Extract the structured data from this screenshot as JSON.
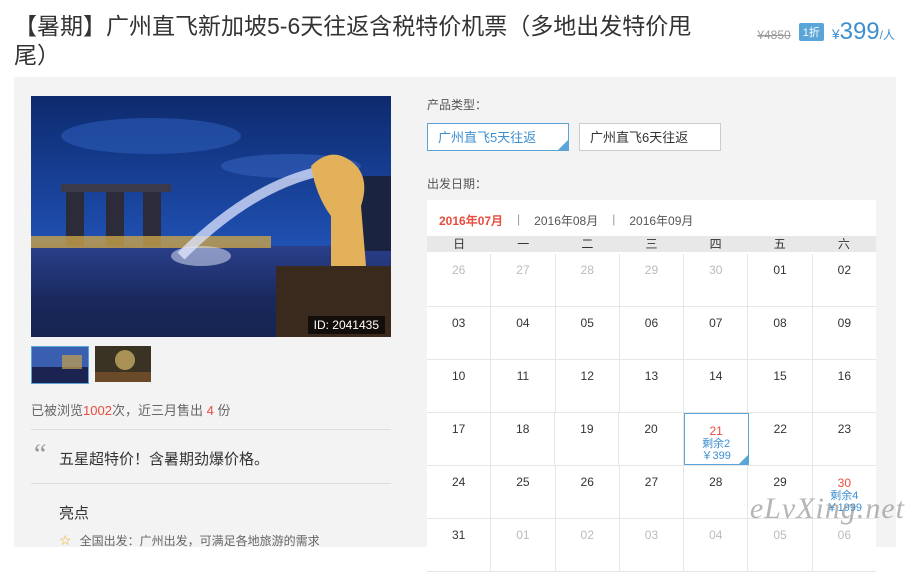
{
  "header": {
    "title": "【暑期】广州直飞新加坡5-6天往返含税特价机票（多地出发特价甩尾）",
    "original_price": "¥4850",
    "discount": "1折",
    "currency": "¥",
    "price": "399",
    "unit": "/人"
  },
  "gallery": {
    "image_id": "ID: 2041435"
  },
  "stats": {
    "prefix": "已被浏览",
    "views": "1002",
    "middle": "次，近三月售出",
    "sold": "4",
    "suffix": "份"
  },
  "highlight": "五星超特价！含暑期劲爆价格。",
  "liangdian": {
    "title": "亮点",
    "feature": "全国出发：广州出发，可满足各地旅游的需求"
  },
  "product": {
    "type_label": "产品类型：",
    "options": [
      "广州直飞5天往返",
      "广州直飞6天往返"
    ],
    "date_label": "出发日期："
  },
  "calendar": {
    "months": [
      "2016年07月",
      "2016年08月",
      "2016年09月"
    ],
    "separator": "|",
    "weekdays": [
      "日",
      "一",
      "二",
      "三",
      "四",
      "五",
      "六"
    ],
    "rows": [
      [
        {
          "d": "26",
          "off": true
        },
        {
          "d": "27",
          "off": true
        },
        {
          "d": "28",
          "off": true
        },
        {
          "d": "29",
          "off": true
        },
        {
          "d": "30",
          "off": true
        },
        {
          "d": "01"
        },
        {
          "d": "02"
        }
      ],
      [
        {
          "d": "03"
        },
        {
          "d": "04"
        },
        {
          "d": "05"
        },
        {
          "d": "06"
        },
        {
          "d": "07"
        },
        {
          "d": "08"
        },
        {
          "d": "09"
        }
      ],
      [
        {
          "d": "10"
        },
        {
          "d": "11"
        },
        {
          "d": "12"
        },
        {
          "d": "13"
        },
        {
          "d": "14"
        },
        {
          "d": "15"
        },
        {
          "d": "16"
        }
      ],
      [
        {
          "d": "17"
        },
        {
          "d": "18"
        },
        {
          "d": "19"
        },
        {
          "d": "20"
        },
        {
          "d": "21",
          "avail": true,
          "selected": true,
          "rem": "剩余2",
          "pr": "￥399"
        },
        {
          "d": "22"
        },
        {
          "d": "23"
        }
      ],
      [
        {
          "d": "24"
        },
        {
          "d": "25"
        },
        {
          "d": "26"
        },
        {
          "d": "27"
        },
        {
          "d": "28"
        },
        {
          "d": "29"
        },
        {
          "d": "30",
          "avail": true,
          "rem": "剩余4",
          "pr": "￥1999"
        }
      ],
      [
        {
          "d": "31"
        },
        {
          "d": "01",
          "off": true
        },
        {
          "d": "02",
          "off": true
        },
        {
          "d": "03",
          "off": true
        },
        {
          "d": "04",
          "off": true
        },
        {
          "d": "05",
          "off": true
        },
        {
          "d": "06",
          "off": true
        }
      ]
    ]
  },
  "watermark": "eLvXing.net",
  "colors": {
    "accent": "#3d8fd0",
    "highlight_red": "#e84c3d",
    "panel_bg": "#f3f3f3"
  }
}
